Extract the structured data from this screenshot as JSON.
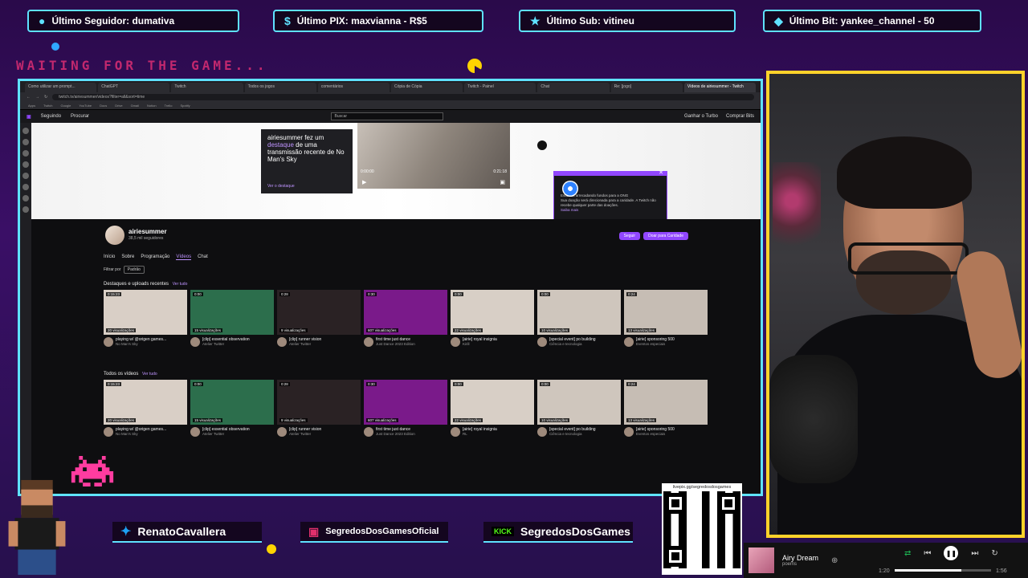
{
  "alerts": {
    "follower": "Último Seguidor: dumativa",
    "pix": "Último PIX: maxvianna - R$5",
    "sub": "Último Sub: vitineu",
    "bit": "Último Bit: yankee_channel - 50"
  },
  "waiting_text": "WAITING FOR THE GAME...",
  "browser": {
    "tabs": [
      "Como utilizar um prompt...",
      "ChatGPT",
      "Twitch",
      "Todos os jogos",
      "comentários",
      "Cópia de Cópia",
      "Twitch - Painel",
      "Chat",
      "Re: [jogo]",
      "Vídeos de airiesummer - Twitch"
    ],
    "active_tab_index": 9,
    "url": "twitch.tv/airiesummer/videos?filter=all&sort=time",
    "bookmarks": [
      "Apps",
      "Twitch",
      "Google",
      "YouTube",
      "Docs",
      "Drive",
      "Gmail",
      "Notion",
      "Trello",
      "Spotify"
    ],
    "nav": {
      "following": "Seguindo",
      "browse": "Procurar",
      "search_placeholder": "Buscar",
      "turbo": "Ganhar o Turbo",
      "bits": "Comprar Bits"
    }
  },
  "feature": {
    "pre": "airiesummer fez um",
    "highlight": "destaque",
    "post": "de uma transmissão recente de No Man's Sky",
    "link": "Ver o destaque",
    "time_a": "0:00:00",
    "time_b": "0:21:18"
  },
  "popup": {
    "text1": "Estamos arrecadando fundos para a ONG",
    "text2": "Sua doação será direcionada para a caridade. A Twitch não recebe qualquer parte das doações.",
    "link": "Saiba mais"
  },
  "channel": {
    "name": "airiesummer",
    "followers": "38,5 mil seguidores",
    "tabs": [
      "Início",
      "Sobre",
      "Programação",
      "Vídeos",
      "Chat"
    ],
    "active_tab": "Vídeos",
    "follow": "Seguir",
    "donate": "Doar para Caridade",
    "filter_label": "Filtrar por",
    "filter_value": "Padrão"
  },
  "sections": {
    "highlights": {
      "title": "Destaques e uploads recentes",
      "link": "Ver tudo"
    },
    "all": {
      "title": "Todos os vídeos",
      "link": "Ver tudo"
    }
  },
  "videos_row1": [
    {
      "dur": "0:15:23",
      "views": "20 visualizações",
      "title": "playing w/ @origen games...",
      "sub": "No Man's Sky",
      "color": "#d9cfc6"
    },
    {
      "dur": "0:00",
      "views": "15 visualizações",
      "title": "[clip] essential observation",
      "sub": "Atelier Twitter",
      "color": "#2c6e4c"
    },
    {
      "dur": "0:28",
      "views": "9 visualizações",
      "title": "[clip] runner vision",
      "sub": "Atelier Twitter",
      "color": "#2a2224"
    },
    {
      "dur": "0:30",
      "views": "607 visualizações",
      "title": "first time just dance",
      "sub": "Just Dance 2023 Edition",
      "color": "#7a1a8a"
    },
    {
      "dur": "0:00",
      "views": "22 visualizações",
      "title": "[airie] royal insignia",
      "sub": "Kirill",
      "color": "#d8cfc6"
    },
    {
      "dur": "0:00",
      "views": "10 visualizações",
      "title": "[special event] po building",
      "sub": "Ciência e tecnologia",
      "color": "#cfc6bd"
    },
    {
      "dur": "0:24",
      "views": "13 visualizações",
      "title": "[airie] sponsoring 500",
      "sub": "Eventos especiais",
      "color": "#c6bdb4"
    }
  ],
  "videos_row2": [
    {
      "dur": "0:15:23",
      "views": "20 visualizações",
      "title": "playing w/ @origen games...",
      "sub": "No Man's Sky",
      "color": "#d9cfc6"
    },
    {
      "dur": "0:00",
      "views": "15 visualizações",
      "title": "[clip] essential observation",
      "sub": "Atelier Twitter",
      "color": "#2c6e4c"
    },
    {
      "dur": "0:28",
      "views": "9 visualizações",
      "title": "[clip] runner vision",
      "sub": "Atelier Twitter",
      "color": "#2a2224"
    },
    {
      "dur": "0:30",
      "views": "607 visualizações",
      "title": "first time just dance",
      "sub": "Just Dance 2023 Edition",
      "color": "#7a1a8a"
    },
    {
      "dur": "0:00",
      "views": "22 visualizações",
      "title": "[airie] royal insignia",
      "sub": "RL",
      "color": "#d8cfc6"
    },
    {
      "dur": "0:00",
      "views": "10 visualizações",
      "title": "[special event] po building",
      "sub": "Ciência e tecnologia",
      "color": "#cfc6bd"
    },
    {
      "dur": "0:24",
      "views": "13 visualizações",
      "title": "[airie] sponsoring 500",
      "sub": "Eventos especiais",
      "color": "#c6bdb4"
    }
  ],
  "social": {
    "twitter": "RenatoCavallera",
    "instagram": "SegredosDosGamesOficial",
    "kick_badge": "KICK",
    "kick": "SegredosDosGames"
  },
  "qr_label": "livepix.gg/segredosdosgames",
  "player": {
    "song": "Airy Dream",
    "artist": "poems",
    "elapsed": "1:20",
    "total": "1:56",
    "progress": 0.69
  },
  "colors": {
    "accent": "#5fe2ff",
    "cam_border": "#ffd22a",
    "twitch": "#9147ff"
  }
}
